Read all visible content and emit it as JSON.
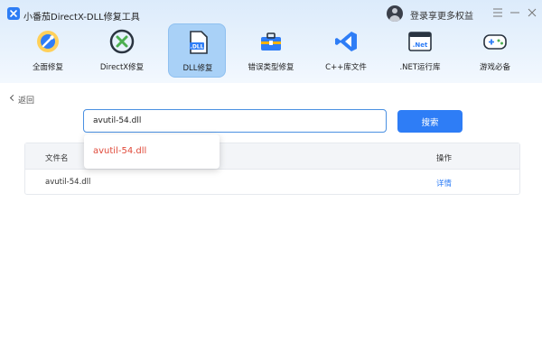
{
  "app": {
    "title": "小番茄DirectX-DLL修复工具",
    "login_text": "登录享更多权益",
    "window_controls": [
      "menu-icon",
      "minimize-icon",
      "close-icon"
    ]
  },
  "toolbar": {
    "items": [
      {
        "label": "全面修复",
        "icon": "wrench-gear-icon"
      },
      {
        "label": "DirectX修复",
        "icon": "directx-icon"
      },
      {
        "label": "DLL修复",
        "icon": "dll-file-icon",
        "active": true
      },
      {
        "label": "错误类型修复",
        "icon": "toolbox-icon"
      },
      {
        "label": "C++库文件",
        "icon": "visual-studio-icon"
      },
      {
        "label": ".NET运行库",
        "icon": "dotnet-icon"
      },
      {
        "label": "游戏必备",
        "icon": "gamepad-icon"
      }
    ]
  },
  "back_label": "返回",
  "search": {
    "value": "avutil-54.dll",
    "button_label": "搜索",
    "suggestions": [
      "avutil-54.dll"
    ]
  },
  "table": {
    "headers": {
      "name": "文件名",
      "action": "操作"
    },
    "rows": [
      {
        "name": "avutil-54.dll",
        "action": "详情"
      }
    ]
  },
  "colors": {
    "accent": "#2e7df6",
    "suggestion_text": "#e04a3a",
    "active_tab": "#a9d1f7"
  }
}
